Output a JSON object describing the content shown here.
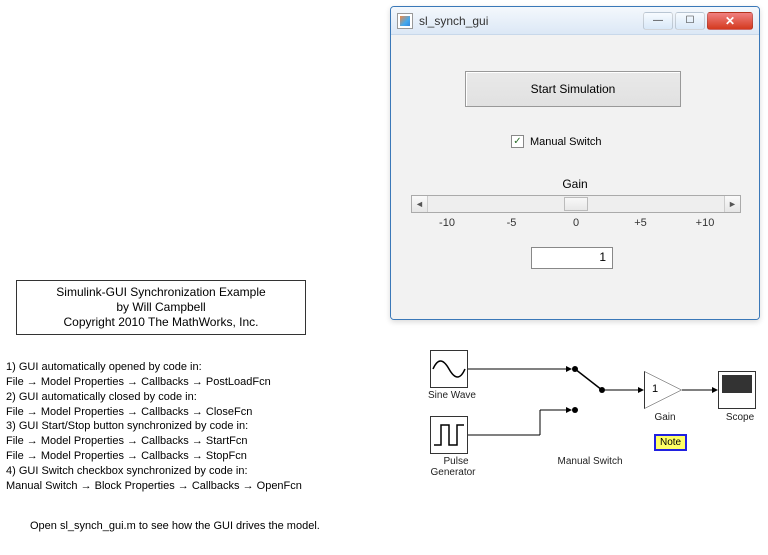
{
  "gui": {
    "title": "sl_synch_gui",
    "start_button": "Start Simulation",
    "checkbox_label": "Manual Switch",
    "checkbox_checked": "✓",
    "gain_label": "Gain",
    "ticks": {
      "t0": "-10",
      "t1": "-5",
      "t2": "0",
      "t3": "+5",
      "t4": "+10"
    },
    "value": "1",
    "win": {
      "min": "—",
      "max": "☐",
      "close": "✕"
    }
  },
  "anno": {
    "line1": "Simulink-GUI Synchronization Example",
    "line2": "by Will Campbell",
    "line3": "Copyright 2010 The MathWorks, Inc."
  },
  "notes": {
    "n1": "1) GUI automatically opened by code in:",
    "n1a": "    File → Model Properties → Callbacks → PostLoadFcn",
    "n2": "2) GUI automatically closed by code in:",
    "n2a": "    File → Model Properties → Callbacks → CloseFcn",
    "n3": "3) GUI Start/Stop button synchronized by code in:",
    "n3a": "    File → Model Properties → Callbacks → StartFcn",
    "n3b": "    File → Model Properties → Callbacks → StopFcn",
    "n4": "4) GUI Switch checkbox synchronized by code in:",
    "n4a": "    Manual Switch → Block Properties → Callbacks → OpenFcn"
  },
  "open_note": "Open sl_synch_gui.m to see how the GUI drives the model.",
  "diagram": {
    "sine": "Sine Wave",
    "pulse": "Pulse\nGenerator",
    "pulse_l1": "Pulse",
    "pulse_l2": "Generator",
    "switch": "Manual Switch",
    "gain": "Gain",
    "gain_val": "1",
    "scope": "Scope",
    "note": "Note"
  }
}
